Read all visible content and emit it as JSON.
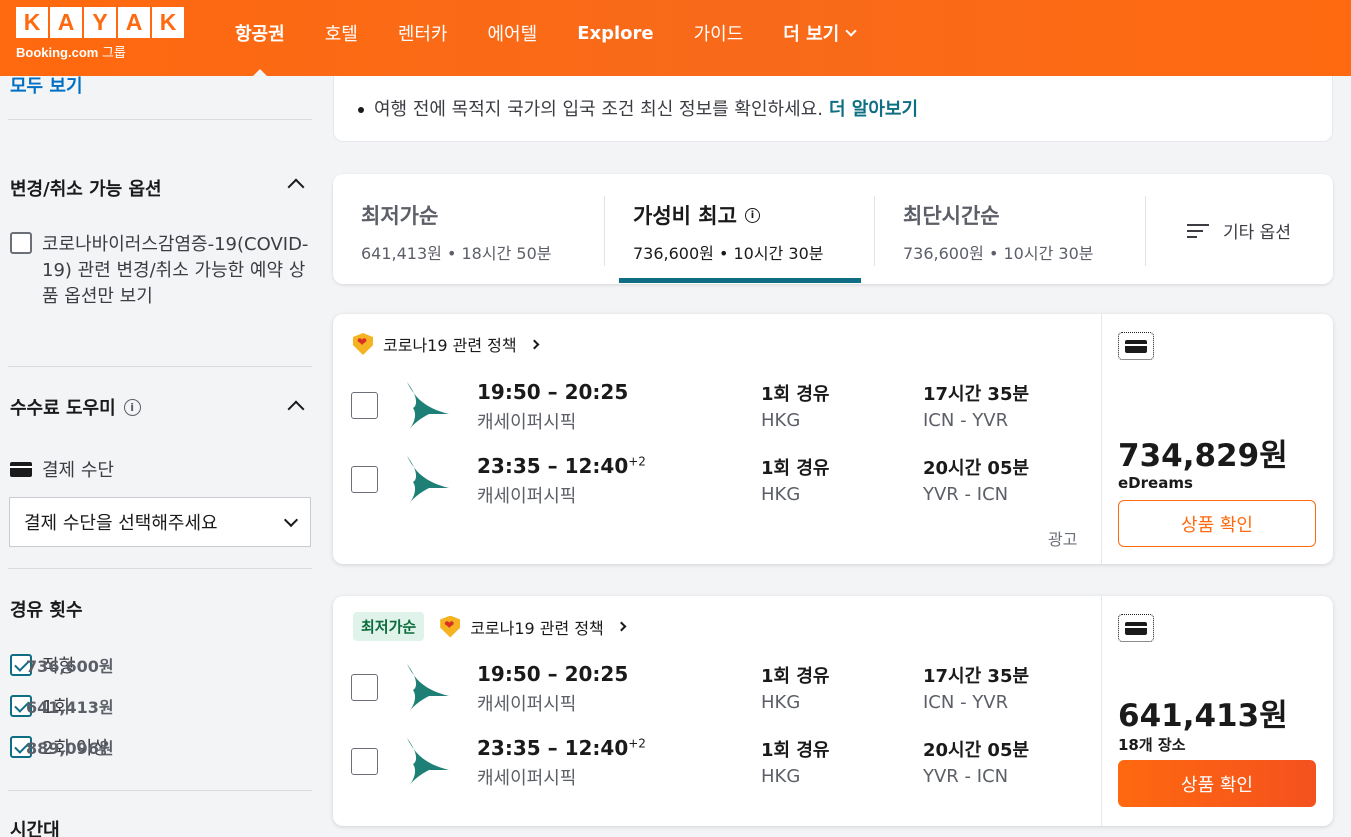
{
  "header": {
    "logo_letters": [
      "K",
      "A",
      "Y",
      "A",
      "K"
    ],
    "logo_sub_bold": "Booking.com",
    "logo_sub": "그룹",
    "nav": [
      {
        "label": "항공권",
        "active": true
      },
      {
        "label": "호텔"
      },
      {
        "label": "렌터카"
      },
      {
        "label": "에어텔"
      },
      {
        "label": "Explore"
      },
      {
        "label": "가이드"
      },
      {
        "label": "더 보기"
      }
    ]
  },
  "sidebar": {
    "see_all": "모두 보기",
    "flex_title": "변경/취소 가능 옵션",
    "covid_option": "코로나바이러스감염증-19(COVID-19) 관련 변경/취소 가능한 예약 상품 옵션만 보기",
    "fee_title": "수수료 도우미",
    "payment_label": "결제 수단",
    "payment_select": "결제 수단을 선택해주세요",
    "stops_title": "경유 횟수",
    "stops": [
      {
        "label": "직항",
        "price": "736,600원",
        "checked": true
      },
      {
        "label": "1회",
        "price": "641,413원",
        "checked": true
      },
      {
        "label": "2회 이상",
        "price": "889,096원",
        "checked": true
      }
    ],
    "time_title": "시간대"
  },
  "notice": {
    "text": "여행 전에 목적지 국가의 입국 조건 최신 정보를 확인하세요.",
    "link": "더 알아보기"
  },
  "sort": {
    "tabs": [
      {
        "title": "최저가순",
        "price": "641,413원",
        "duration": "18시간 50분"
      },
      {
        "title": "가성비 최고",
        "price": "736,600원",
        "duration": "10시간 30분",
        "active": true
      },
      {
        "title": "최단시간순",
        "price": "736,600원",
        "duration": "10시간 30분"
      }
    ],
    "more": "기타 옵션"
  },
  "results": [
    {
      "tag": "",
      "policy": "코로나19 관련 정책",
      "legs": [
        {
          "times": "19:50 – 20:25",
          "plus": "",
          "airline": "캐세이퍼시픽",
          "stops": "1회 경유",
          "via": "HKG",
          "duration": "17시간 35분",
          "route": "ICN - YVR"
        },
        {
          "times": "23:35 – 12:40",
          "plus": "+2",
          "airline": "캐세이퍼시픽",
          "stops": "1회 경유",
          "via": "HKG",
          "duration": "20시간 05분",
          "route": "YVR - ICN"
        }
      ],
      "ad": "광고",
      "price": "734,829원",
      "provider": "eDreams",
      "button": "상품 확인"
    },
    {
      "tag": "최저가순",
      "policy": "코로나19 관련 정책",
      "legs": [
        {
          "times": "19:50 – 20:25",
          "plus": "",
          "airline": "캐세이퍼시픽",
          "stops": "1회 경유",
          "via": "HKG",
          "duration": "17시간 35분",
          "route": "ICN - YVR"
        },
        {
          "times": "23:35 – 12:40",
          "plus": "+2",
          "airline": "캐세이퍼시픽",
          "stops": "1회 경유",
          "via": "HKG",
          "duration": "20시간 05분",
          "route": "YVR - ICN"
        }
      ],
      "price": "641,413원",
      "provider": "18개 장소",
      "button": "상품 확인"
    }
  ],
  "colors": {
    "brand": "#ff690f",
    "accent": "#0f6e84",
    "link": "#0071c2"
  }
}
